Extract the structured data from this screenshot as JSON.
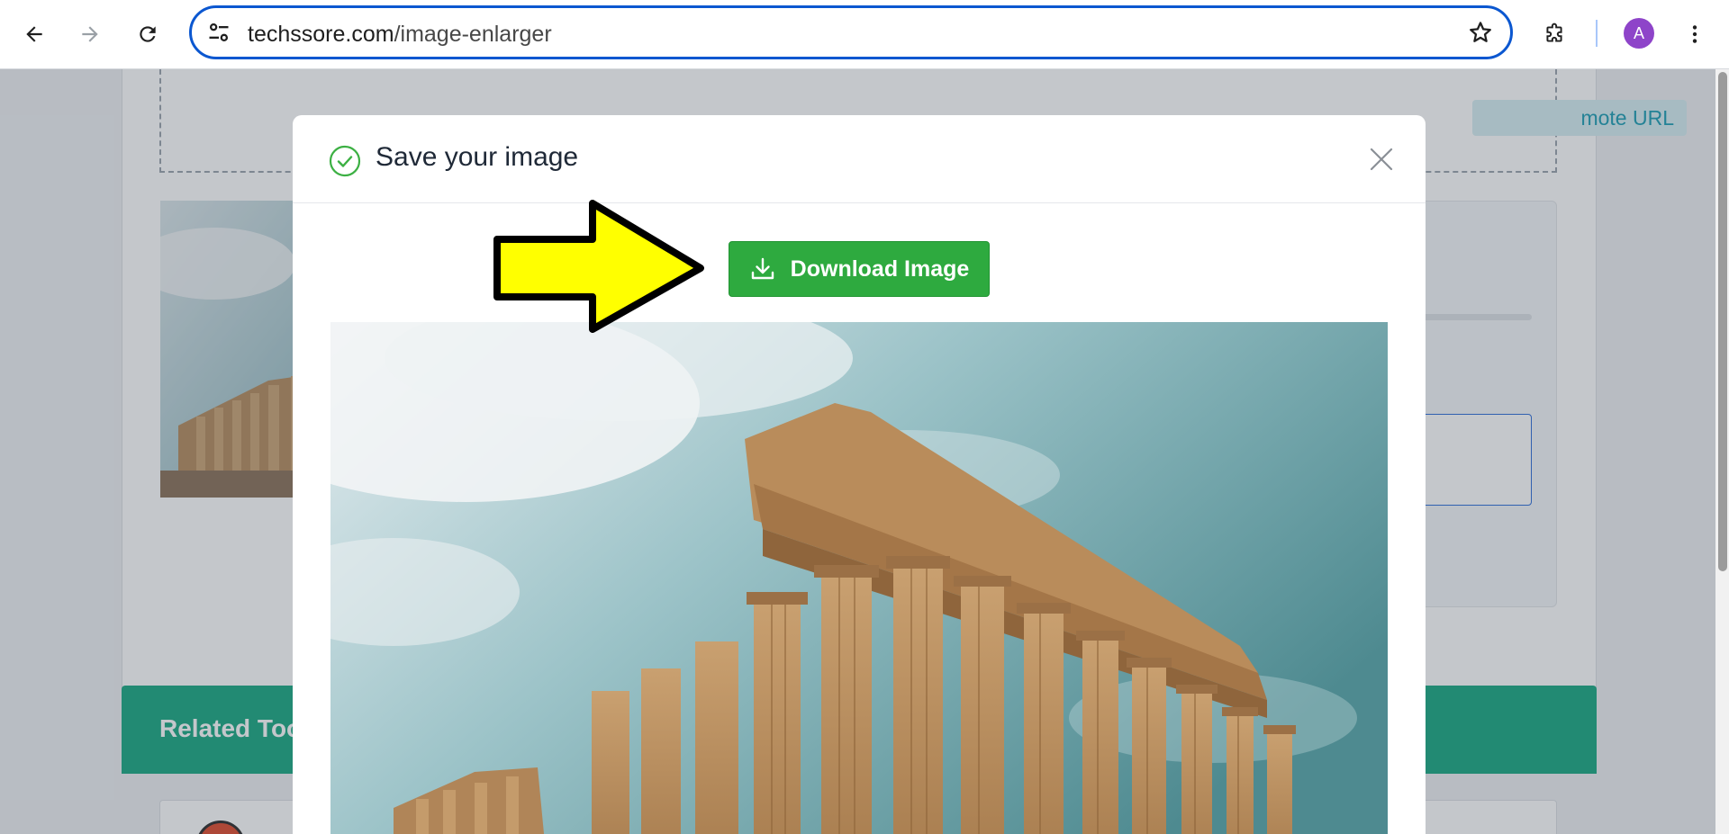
{
  "browser": {
    "url_domain": "techssore.com",
    "url_path": "/image-enlarger",
    "avatar_letter": "A",
    "icons": [
      "back-arrow-icon",
      "forward-arrow-icon",
      "reload-icon",
      "site-settings-icon",
      "bookmark-star-icon",
      "extensions-puzzle-icon",
      "kebab-menu-icon"
    ]
  },
  "page": {
    "remote_url_label": "mote URL",
    "related_title": "Related Too"
  },
  "modal": {
    "title": "Save your image",
    "download_label": "Download Image",
    "colors": {
      "download_button": "#2eaa3f",
      "success_check": "#3cb043",
      "related_header": "#17a882",
      "annotation_arrow": "#ffff00"
    }
  }
}
